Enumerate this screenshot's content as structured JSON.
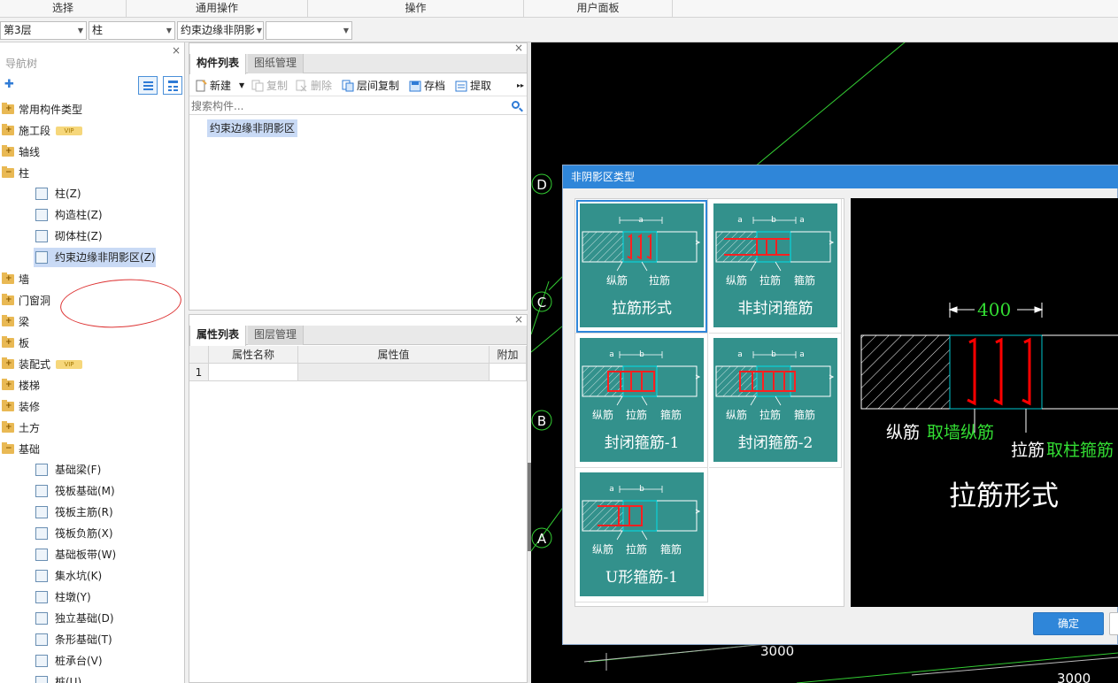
{
  "ribbon": {
    "select": "选择",
    "common_ops": "通用操作",
    "operations": "操作",
    "user_panel": "用户面板"
  },
  "combos": {
    "floor": "第3层",
    "category": "柱",
    "component_type": "约束边缘非阴影",
    "component": ""
  },
  "nav": {
    "title": "导航树",
    "close": "×",
    "vip_badge": "VIP",
    "items": [
      {
        "label": "常用构件类型"
      },
      {
        "label": "施工段",
        "vip": true
      },
      {
        "label": "轴线"
      },
      {
        "label": "柱"
      },
      {
        "label": "墙"
      },
      {
        "label": "门窗洞"
      },
      {
        "label": "梁"
      },
      {
        "label": "板"
      },
      {
        "label": "装配式",
        "vip": true
      },
      {
        "label": "楼梯"
      },
      {
        "label": "装修"
      },
      {
        "label": "土方"
      },
      {
        "label": "基础"
      }
    ],
    "column_children": [
      "柱(Z)",
      "构造柱(Z)",
      "砌体柱(Z)",
      "约束边缘非阴影区(Z)"
    ],
    "foundation_children": [
      "基础梁(F)",
      "筏板基础(M)",
      "筏板主筋(R)",
      "筏板负筋(X)",
      "基础板带(W)",
      "集水坑(K)",
      "柱墩(Y)",
      "独立基础(D)",
      "条形基础(T)",
      "桩承台(V)",
      "桩(U)"
    ]
  },
  "component_panel": {
    "close": "×",
    "tab_list": "构件列表",
    "tab_drawings": "图纸管理",
    "toolbar": {
      "new": "新建",
      "copy": "复制",
      "delete": "删除",
      "floor_copy": "层间复制",
      "archive": "存档",
      "extract": "提取",
      "more": "▸▸"
    },
    "search_placeholder": "搜索构件...",
    "items": [
      "约束边缘非阴影区"
    ]
  },
  "property_panel": {
    "close": "×",
    "tab_props": "属性列表",
    "tab_layers": "图层管理",
    "headers": [
      "属性名称",
      "属性值",
      "附加"
    ],
    "rows": [
      {
        "no": "1",
        "name": "",
        "value": "",
        "extra": ""
      }
    ]
  },
  "canvas": {
    "axes": [
      "D",
      "C",
      "B",
      "A"
    ],
    "dims": [
      "3000",
      "3000"
    ]
  },
  "dialog": {
    "title": "非阴影区类型",
    "confirm": "确定",
    "tiles": [
      {
        "name": "拉筋形式",
        "labels": [
          "纵筋",
          "拉筋"
        ],
        "dims": [
          "a"
        ]
      },
      {
        "name": "非封闭箍筋",
        "labels": [
          "纵筋",
          "拉筋",
          "箍筋"
        ],
        "dims": [
          "a",
          "b",
          "a"
        ]
      },
      {
        "name": "封闭箍筋-1",
        "labels": [
          "纵筋",
          "拉筋",
          "箍筋"
        ],
        "dims": [
          "a",
          "b"
        ]
      },
      {
        "name": "封闭箍筋-2",
        "labels": [
          "纵筋",
          "拉筋",
          "箍筋"
        ],
        "dims": [
          "a",
          "b",
          "a"
        ]
      },
      {
        "name": "U形箍筋-1",
        "labels": [
          "纵筋",
          "拉筋",
          "箍筋"
        ],
        "dims": [
          "a",
          "b"
        ]
      }
    ],
    "preview": {
      "dim": "400",
      "long_bar": "纵筋",
      "long_bar_note": "取墙纵筋",
      "tie": "拉筋",
      "tie_note": "取柱箍筋",
      "title": "拉筋形式"
    }
  },
  "colors": {
    "accent": "#2f86d9",
    "tile": "#33918c",
    "rebar": "#ff0000",
    "cyan": "#00c8d0",
    "dim_green": "#33dd33"
  }
}
